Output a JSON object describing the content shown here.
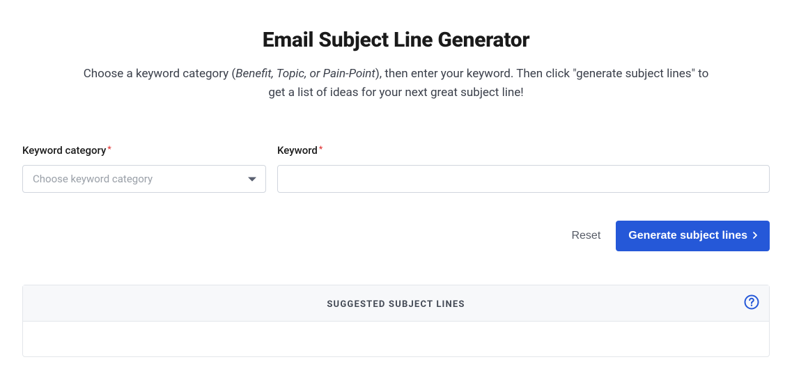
{
  "header": {
    "title": "Email Subject Line Generator",
    "subtitle_pre": "Choose a keyword category (",
    "subtitle_em": "Benefit, Topic, or Pain-Point",
    "subtitle_post": "), then enter your keyword. Then click \"generate subject lines\" to get a list of ideas for your next great subject line!"
  },
  "form": {
    "category_label": "Keyword category",
    "category_placeholder": "Choose keyword category",
    "keyword_label": "Keyword",
    "keyword_value": ""
  },
  "buttons": {
    "reset": "Reset",
    "generate": "Generate subject lines"
  },
  "results": {
    "title": "SUGGESTED SUBJECT LINES"
  }
}
